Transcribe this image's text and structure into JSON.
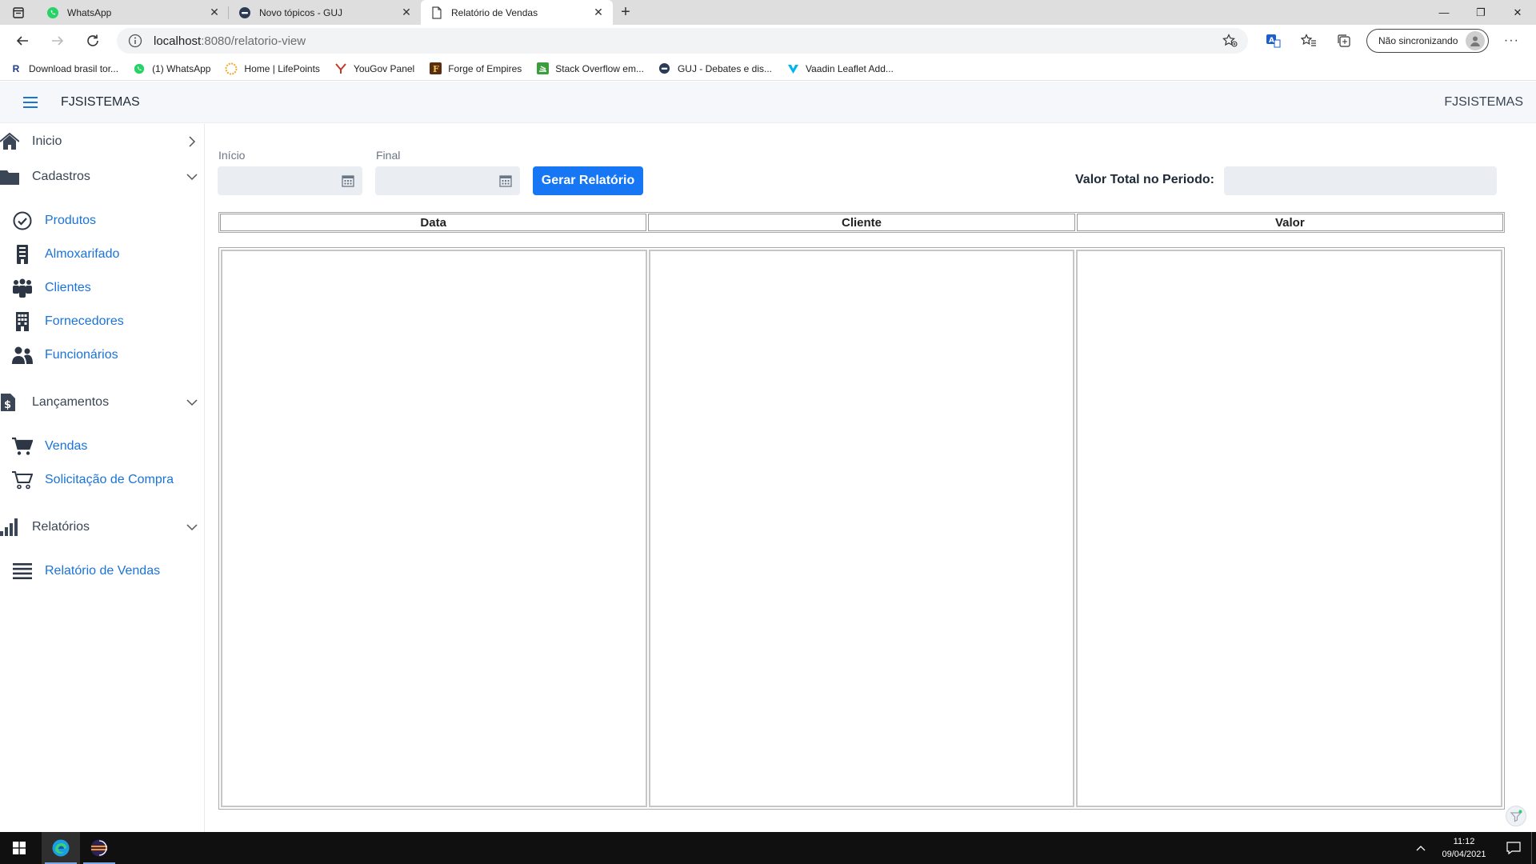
{
  "browser": {
    "tabs": [
      {
        "title": "WhatsApp",
        "active": false
      },
      {
        "title": "Novo tópicos - GUJ",
        "active": false
      },
      {
        "title": "Relatório de Vendas",
        "active": true
      }
    ],
    "url_host": "localhost",
    "url_path": ":8080/relatorio-view",
    "sync_label": "Não sincronizando",
    "bookmarks": [
      {
        "label": "Download brasil tor...",
        "icon": "r-letter-icon"
      },
      {
        "label": "(1) WhatsApp",
        "icon": "whatsapp-icon"
      },
      {
        "label": "Home | LifePoints",
        "icon": "lifepoints-icon"
      },
      {
        "label": "YouGov Panel",
        "icon": "yougov-icon"
      },
      {
        "label": "Forge of Empires",
        "icon": "foe-icon"
      },
      {
        "label": "Stack Overflow em...",
        "icon": "stackoverflow-icon"
      },
      {
        "label": "GUJ - Debates e dis...",
        "icon": "guj-icon"
      },
      {
        "label": "Vaadin Leaflet Add...",
        "icon": "vaadin-icon"
      }
    ]
  },
  "app": {
    "brand": "FJSISTEMAS",
    "brand_right": "FJSISTEMAS"
  },
  "sidebar": {
    "sections": [
      {
        "label": "Inicio",
        "icon": "home-icon",
        "expanded": false
      },
      {
        "label": "Cadastros",
        "icon": "folder-icon",
        "expanded": true
      },
      {
        "label": "Lançamentos",
        "icon": "invoice-icon",
        "expanded": true
      },
      {
        "label": "Relatórios",
        "icon": "bar-chart-icon",
        "expanded": true
      }
    ],
    "items": [
      {
        "label": "Produtos",
        "icon": "check-circle-icon"
      },
      {
        "label": "Almoxarifado",
        "icon": "building-icon"
      },
      {
        "label": "Clientes",
        "icon": "users-icon"
      },
      {
        "label": "Fornecedores",
        "icon": "office-building-icon"
      },
      {
        "label": "Funcionários",
        "icon": "user-group-icon"
      },
      {
        "label": "Vendas",
        "icon": "cart-icon"
      },
      {
        "label": "Solicitação de Compra",
        "icon": "cart-outline-icon"
      },
      {
        "label": "Relatório de Vendas",
        "icon": "list-icon"
      }
    ]
  },
  "form": {
    "start_label": "Início",
    "start_value": "",
    "end_label": "Final",
    "end_value": "",
    "generate_button": "Gerar Relatório",
    "total_label": "Valor Total no Periodo:",
    "total_value": ""
  },
  "table": {
    "columns": [
      "Data",
      "Cliente",
      "Valor"
    ],
    "rows": []
  },
  "taskbar": {
    "time": "11:12",
    "date": "09/04/2021"
  },
  "colors": {
    "accent": "#1676f3",
    "link": "#1a73d9",
    "field_bg": "#eaedf1"
  }
}
